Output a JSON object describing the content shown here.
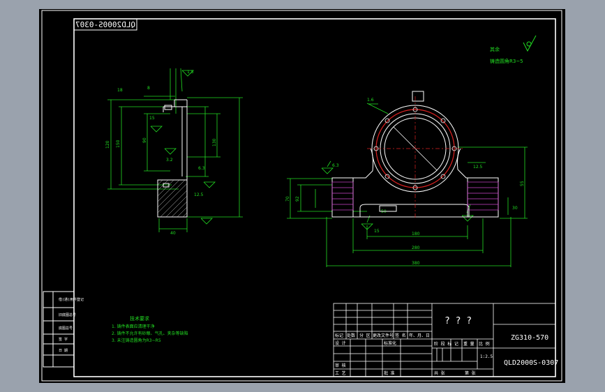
{
  "app": {
    "background": "#9aa2ad",
    "canvas_color": "#000000"
  },
  "colors": {
    "frame": "#ffffff",
    "dimension": "#22dd22",
    "outline": "#ffffff",
    "flange": "#dd2222",
    "hatch": "#cc44cc"
  },
  "drawing": {
    "mirrored_code": "QLD2000S-0307",
    "top_note_1": "其余",
    "top_note_2": "铸造圆角R3~5",
    "roughness_symbol": "√",
    "technical_title": "技术要求",
    "technical_items": [
      "1. 铸件表面应清理干净",
      "2. 铸件不允许有砂眼、气孔、夹杂等缺陷",
      "3. 未注铸造圆角为R3~R5"
    ],
    "left_view_dims": [
      "1.5",
      "18",
      "8",
      "15",
      "120",
      "150",
      "90",
      "130",
      "6.3",
      "3.2",
      "12.5",
      "40"
    ],
    "main_view_dims": [
      "1.6",
      "6.3",
      "15",
      "12.5",
      "50",
      "30",
      "180",
      "280",
      "380",
      "70",
      "92",
      "55"
    ]
  },
  "side_table": {
    "rows": [
      "借(通)用件登记",
      "旧底图总号",
      "底图总号",
      "签  字",
      "日  期"
    ]
  },
  "title_block": {
    "header_row": [
      "标记",
      "处数",
      "分 区",
      "更改文件号",
      "签 名",
      "年、月、日"
    ],
    "design": "设 计",
    "standardize": "标准化",
    "check": "审 核",
    "process": "工 艺",
    "approve": "批 准",
    "stage_labels": [
      "阶 段 标 记",
      "重 量",
      "比 例"
    ],
    "scale": "1:2.5",
    "sheet_total": "共   张",
    "sheet_index": "第   张",
    "title": "? ? ?",
    "material": "ZG310-570",
    "drawing_number": "QLD2000S-0307"
  }
}
